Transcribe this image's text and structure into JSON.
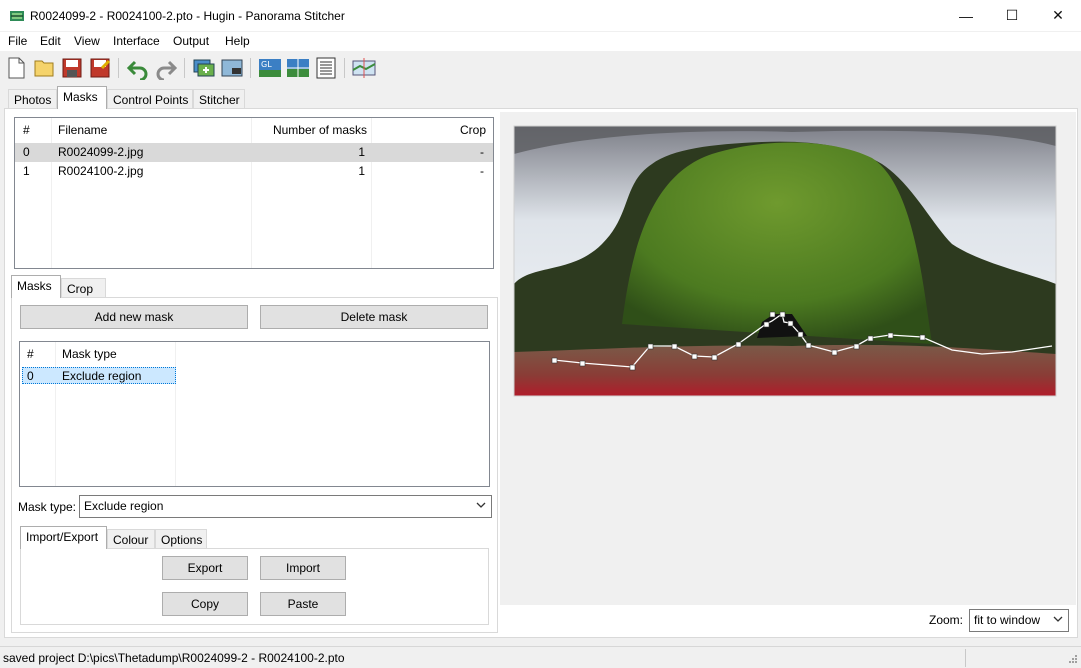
{
  "window": {
    "title": "R0024099-2 - R0024100-2.pto - Hugin - Panorama Stitcher",
    "minimize": "—",
    "maximize": "☐",
    "close": "✕"
  },
  "menu": [
    "File",
    "Edit",
    "View",
    "Interface",
    "Output",
    "Help"
  ],
  "main_tabs": [
    "Photos",
    "Masks",
    "Control Points",
    "Stitcher"
  ],
  "images_table": {
    "headers": [
      "#",
      "Filename",
      "Number of masks",
      "Crop"
    ],
    "rows": [
      {
        "index": "0",
        "filename": "R0024099-2.jpg",
        "masks": "1",
        "crop": "-"
      },
      {
        "index": "1",
        "filename": "R0024100-2.jpg",
        "masks": "1",
        "crop": "-"
      }
    ]
  },
  "sub_tabs": [
    "Masks",
    "Crop"
  ],
  "mask_buttons": {
    "add": "Add new mask",
    "delete": "Delete mask"
  },
  "mask_table": {
    "headers": [
      "#",
      "Mask type"
    ],
    "rows": [
      {
        "index": "0",
        "type": "Exclude region"
      }
    ]
  },
  "mask_type": {
    "label": "Mask type:",
    "value": "Exclude region"
  },
  "bottom_tabs": [
    "Import/Export",
    "Colour",
    "Options"
  ],
  "io_buttons": {
    "export": "Export",
    "import": "Import",
    "copy": "Copy",
    "paste": "Paste"
  },
  "zoom": {
    "label": "Zoom:",
    "value": "fit to window"
  },
  "status": "saved project D:\\pics\\Thetadump\\R0024099-2 - R0024100-2.pto",
  "colors": {
    "selection": "#cce8ff",
    "selected_row": "#d9d9d9",
    "accent": "#0078d7"
  }
}
